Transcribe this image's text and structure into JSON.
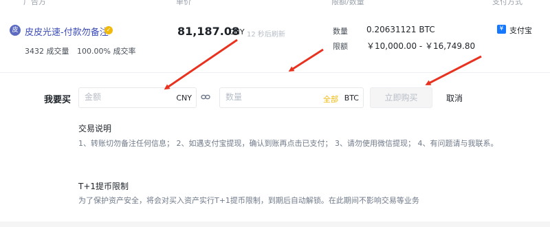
{
  "header": {
    "columns": [
      "广告方",
      "单价",
      "限额/数量",
      "支付方式"
    ]
  },
  "offer": {
    "avatar_char": "皮",
    "merchant_name": "皮皮光速-付款勿备注",
    "verified_icon": "✓",
    "trade_count": "3432 成交量",
    "completion_rate": "100.00% 成交率",
    "price": "81,187.08",
    "price_currency": "CNY",
    "refresh_text": "12 秒后刷新",
    "quantity_label": "数量",
    "quantity_value": "0.20631121 BTC",
    "limit_label": "限额",
    "limit_value": "￥10,000.00 - ￥16,749.80",
    "payment_icon_char": "¥",
    "payment_method": "支付宝"
  },
  "buy_form": {
    "label": "我要买",
    "amount_placeholder": "金额",
    "amount_unit": "CNY",
    "quantity_placeholder": "数量",
    "all_label": "全部",
    "quantity_unit": "BTC",
    "buy_button": "立即购买",
    "cancel_button": "取消"
  },
  "notes": {
    "trade_title": "交易说明",
    "trade_text": "1、转账切勿备注任何信息； 2、如遇支付宝提现，确认到账再点击已支付； 3、请勿使用微信提现； 4、有问题请与我联系。",
    "limit_title": "T+1提币限制",
    "limit_text": "为了保护资产安全，将会对买入资产实行T+1提币限制，到期后自动解锁。在此期间不影响交易等业务"
  },
  "colors": {
    "accent": "#f0b90b",
    "arrow": "#e8321f",
    "merchant_link": "#3b4cb8"
  }
}
